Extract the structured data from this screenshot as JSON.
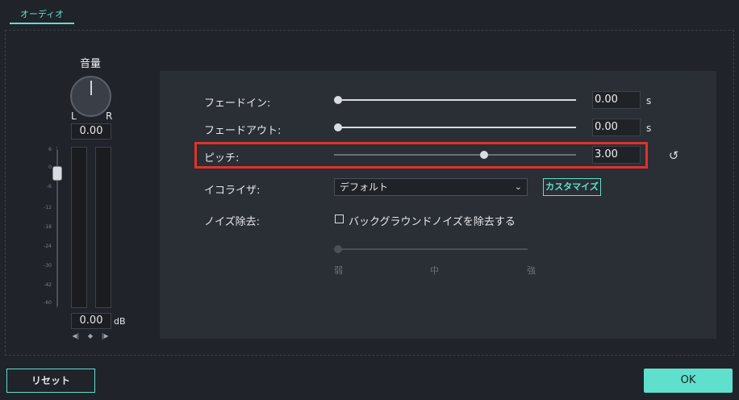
{
  "tabs": [
    {
      "label": "オーディオ",
      "active": true
    }
  ],
  "volume": {
    "title": "音量",
    "left_label": "L",
    "right_label": "R",
    "pan_value": "0.00",
    "db_value": "0.00",
    "db_unit": "dB",
    "scale_ticks": [
      "6",
      "0",
      "-6",
      "-12",
      "-18",
      "-24",
      "-30",
      "-42",
      "-60",
      "-∞"
    ]
  },
  "rows": {
    "fade_in": {
      "label": "フェードイン:",
      "value": "0.00",
      "unit": "s",
      "level": 0
    },
    "fade_out": {
      "label": "フェードアウト:",
      "value": "0.00",
      "unit": "s",
      "level": 0
    },
    "pitch": {
      "label": "ピッチ:",
      "value": "3.00",
      "level": 0.62
    },
    "equalizer": {
      "label": "イコライザ:",
      "selected": "デフォルト",
      "customize_label": "カスタマイズ"
    },
    "noise": {
      "label": "ノイズ除去:",
      "checkbox_label": "バックグラウンドノイズを除去する",
      "checked": false,
      "marks": [
        "弱",
        "中",
        "強"
      ]
    }
  },
  "buttons": {
    "reset": "リセット",
    "ok": "OK"
  },
  "colors": {
    "accent": "#5ee0cc",
    "highlight": "#e0322c"
  },
  "icons": {
    "reset_pitch": "refresh-icon",
    "dropdown": "chevron-down-icon"
  }
}
